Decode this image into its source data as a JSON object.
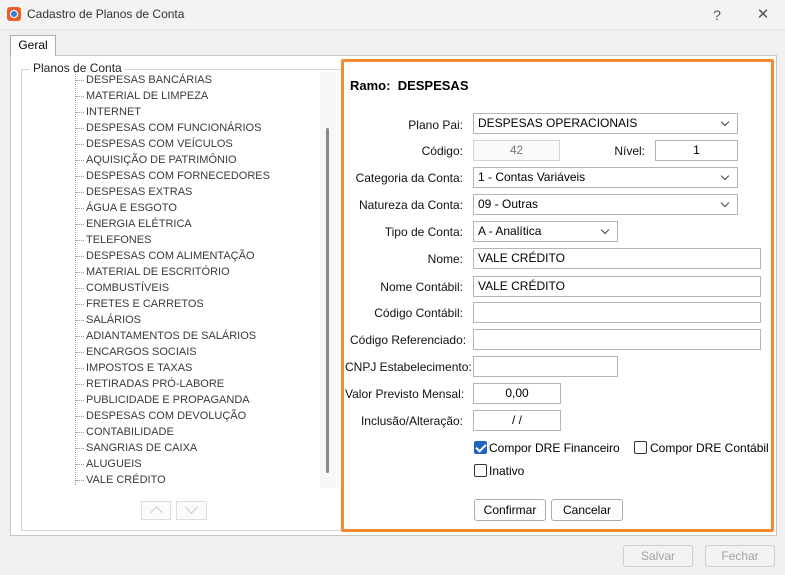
{
  "window": {
    "title": "Cadastro de Planos de Conta",
    "help": "?",
    "close": "✕"
  },
  "tabs": [
    {
      "label": "Geral"
    }
  ],
  "tree": {
    "legend": "Planos de Conta",
    "items": [
      "DESPESAS BANCÁRIAS",
      "MATERIAL DE LIMPEZA",
      "INTERNET",
      "DESPESAS COM FUNCIONÁRIOS",
      "DESPESAS COM VEÍCULOS",
      "AQUISIÇÃO DE PATRIMÔNIO",
      "DESPESAS COM FORNECEDORES",
      "DESPESAS EXTRAS",
      "ÁGUA E ESGOTO",
      "ENERGIA ELÉTRICA",
      "TELEFONES",
      "DESPESAS COM ALIMENTAÇÃO",
      "MATERIAL DE ESCRITÓRIO",
      "COMBUSTÍVEIS",
      "FRETES E CARRETOS",
      "SALÁRIOS",
      "ADIANTAMENTOS DE SALÁRIOS",
      "ENCARGOS SOCIAIS",
      "IMPOSTOS E TAXAS",
      "RETIRADAS PRÓ-LABORE",
      "PUBLICIDADE E PROPAGANDA",
      "DESPESAS COM DEVOLUÇÃO",
      "CONTABILIDADE",
      "SANGRIAS DE CAIXA",
      "ALUGUEIS",
      "VALE CRÉDITO"
    ]
  },
  "form": {
    "ramo_label": "Ramo:",
    "ramo_value": "DESPESAS",
    "plano_pai": {
      "label": "Plano Pai:",
      "value": "DESPESAS OPERACIONAIS"
    },
    "codigo": {
      "label": "Código:",
      "value": "42"
    },
    "nivel": {
      "label": "Nível:",
      "value": "1"
    },
    "categoria": {
      "label": "Categoria da Conta:",
      "value": "1 - Contas Variáveis"
    },
    "natureza": {
      "label": "Natureza da Conta:",
      "value": "09 - Outras"
    },
    "tipo": {
      "label": "Tipo de Conta:",
      "value": "A - Analítica"
    },
    "nome": {
      "label": "Nome:",
      "value": "VALE CRÉDITO"
    },
    "nome_contabil": {
      "label": "Nome Contábil:",
      "value": "VALE CRÉDITO"
    },
    "codigo_contabil": {
      "label": "Código Contábil:",
      "value": ""
    },
    "codigo_referenciado": {
      "label": "Código Referenciado:",
      "value": ""
    },
    "cnpj": {
      "label": "CNPJ Estabelecimento:",
      "value": ""
    },
    "valor_previsto": {
      "label": "Valor Previsto Mensal:",
      "value": "0,00"
    },
    "inclusao": {
      "label": "Inclusão/Alteração:",
      "value": "/  /"
    },
    "checkboxes": {
      "dre_financeiro": {
        "label": "Compor DRE Financeiro",
        "checked": true
      },
      "dre_contabil": {
        "label": "Compor DRE Contábil",
        "checked": false
      },
      "inativo": {
        "label": "Inativo",
        "checked": false
      }
    },
    "confirmar": "Confirmar",
    "cancelar": "Cancelar"
  },
  "footer": {
    "salvar": "Salvar",
    "fechar": "Fechar"
  },
  "colors": {
    "highlight": "#f28a33",
    "checkbox_checked": "#1f64bf"
  }
}
